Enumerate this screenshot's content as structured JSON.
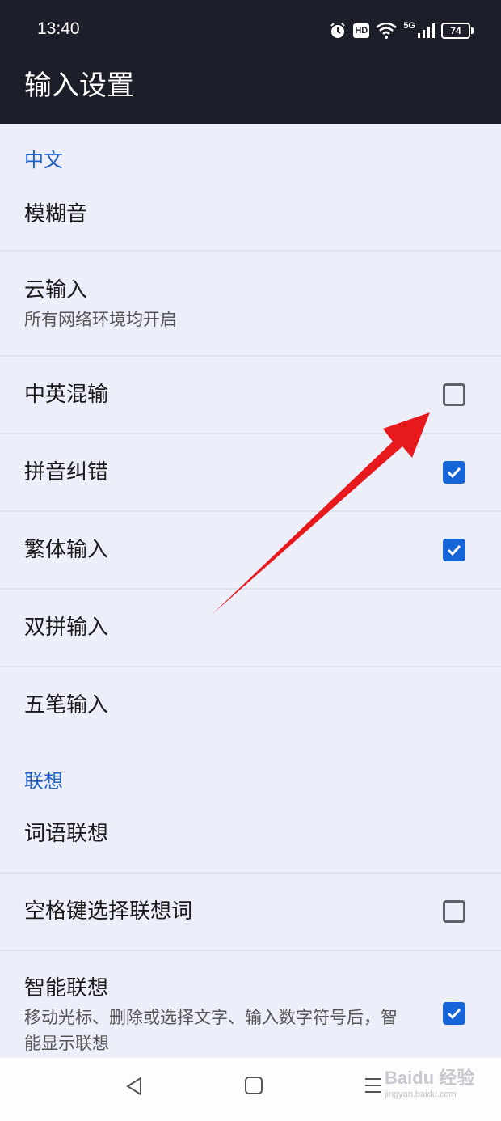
{
  "status_bar": {
    "time": "13:40",
    "hd_label": "HD",
    "network_label": "5G",
    "battery_level": "74",
    "icons": [
      "alarm-icon",
      "hd-icon",
      "wifi-icon",
      "signal-icon",
      "battery-icon"
    ]
  },
  "header": {
    "title": "输入设置"
  },
  "sections": {
    "chinese": {
      "title": "中文",
      "fuzzy_pinyin": {
        "title": "模糊音"
      },
      "cloud_input": {
        "title": "云输入",
        "summary": "所有网络环境均开启"
      },
      "mixed_input": {
        "title": "中英混输",
        "checked": false
      },
      "pinyin_correction": {
        "title": "拼音纠错",
        "checked": true
      },
      "traditional_input": {
        "title": "繁体输入",
        "checked": true
      },
      "double_pinyin": {
        "title": "双拼输入"
      },
      "wubi_input": {
        "title": "五笔输入"
      }
    },
    "association": {
      "title": "联想",
      "word_association": {
        "title": "词语联想"
      },
      "space_select": {
        "title": "空格键选择联想词",
        "checked": false
      },
      "smart_association": {
        "title": "智能联想",
        "summary": "移动光标、删除或选择文字、输入数字符号后，智能显示联想",
        "checked": true
      }
    }
  },
  "nav_bar": {
    "icons": [
      "back-icon",
      "home-icon",
      "menu-icon"
    ]
  },
  "watermark": {
    "brand": "Baidu 经验",
    "url": "jingyan.baidu.com"
  },
  "colors": {
    "header_bg": "#1c1f2a",
    "page_bg": "#eceffa",
    "accent": "#1d5fc4",
    "checkbox_on": "#1565d8",
    "annotation_arrow": "#e8191d"
  }
}
